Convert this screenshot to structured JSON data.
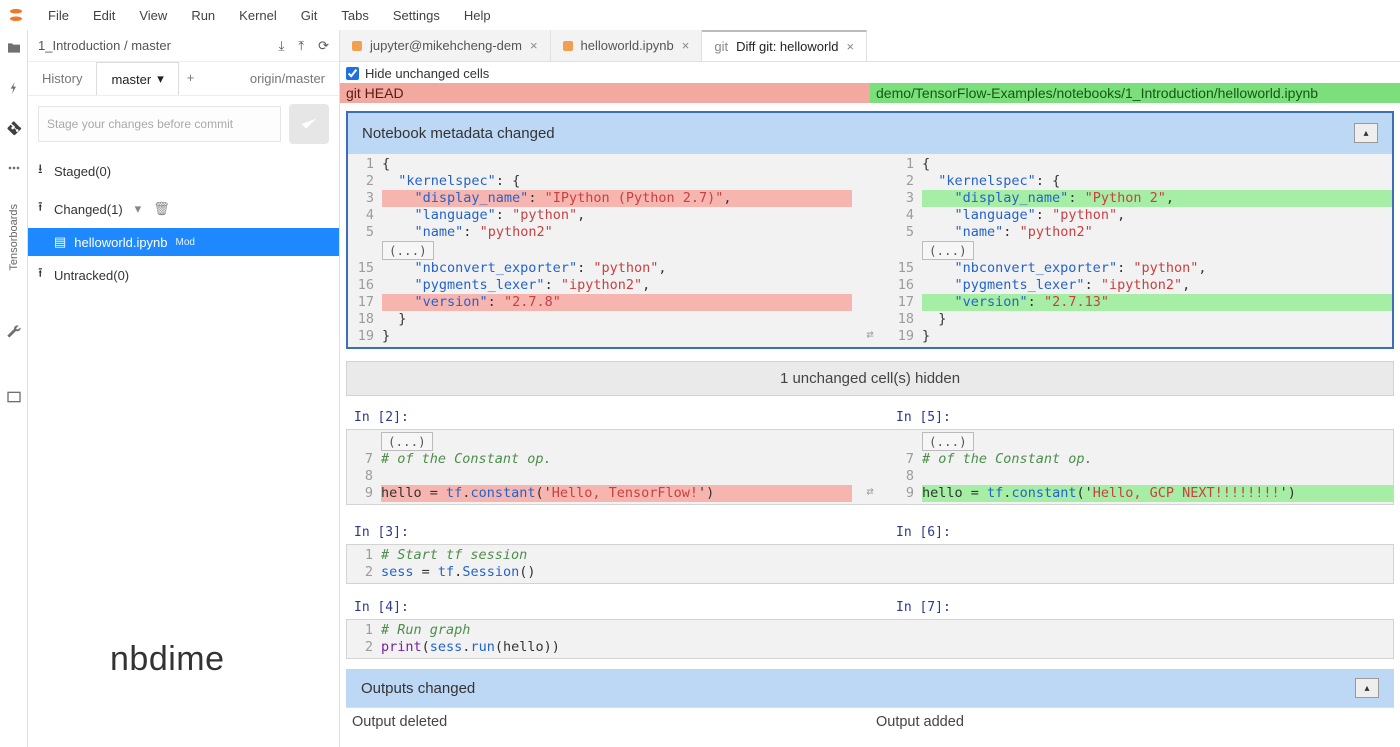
{
  "menu": {
    "items": [
      "File",
      "Edit",
      "View",
      "Run",
      "Kernel",
      "Git",
      "Tabs",
      "Settings",
      "Help"
    ]
  },
  "activity": {
    "sidetext": "Tensorboards"
  },
  "sidebar": {
    "breadcrumb": "1_Introduction / master",
    "tabs": {
      "history": "History",
      "active_branch": "master",
      "remote": "origin/master"
    },
    "commit_placeholder": "Stage your changes before commit",
    "sections": {
      "staged": "Staged(0)",
      "changed": "Changed(1)",
      "untracked": "Untracked(0)"
    },
    "changed_file": {
      "name": "helloworld.ipynb",
      "badge": "Mod"
    }
  },
  "editor_tabs": [
    {
      "dot": "#f0a050",
      "label": "jupyter@mikehcheng-dem",
      "close": "×"
    },
    {
      "dot": "#f0a050",
      "label": "helloworld.ipynb",
      "close": "×"
    },
    {
      "dot": "",
      "label": "Diff git: helloworld",
      "prefix": "git",
      "close": "×",
      "active": true
    }
  ],
  "diff": {
    "hide_checkbox_label": "Hide unchanged cells",
    "banner_left": "git HEAD",
    "banner_right": "demo/TensorFlow-Examples/notebooks/1_Introduction/helloworld.ipynb",
    "meta_title": "Notebook metadata changed",
    "left_lines": [
      {
        "n": "1",
        "t": "{"
      },
      {
        "n": "2",
        "t": "  \"kernelspec\": {"
      },
      {
        "n": "3",
        "t": "    \"display_name\": \"IPython (Python 2.7)\",",
        "cls": "del"
      },
      {
        "n": "4",
        "t": "    \"language\": \"python\","
      },
      {
        "n": "5",
        "t": "    \"name\": \"python2\""
      }
    ],
    "left_fold": "(...)",
    "left_lines2": [
      {
        "n": "15",
        "t": "    \"nbconvert_exporter\": \"python\","
      },
      {
        "n": "16",
        "t": "    \"pygments_lexer\": \"ipython2\","
      },
      {
        "n": "17",
        "t": "    \"version\": \"2.7.8\"",
        "cls": "del"
      },
      {
        "n": "18",
        "t": "  }"
      },
      {
        "n": "19",
        "t": "}"
      }
    ],
    "right_lines": [
      {
        "n": "1",
        "t": "{"
      },
      {
        "n": "2",
        "t": "  \"kernelspec\": {"
      },
      {
        "n": "3",
        "t": "    \"display_name\": \"Python 2\",",
        "cls": "add"
      },
      {
        "n": "4",
        "t": "    \"language\": \"python\","
      },
      {
        "n": "5",
        "t": "    \"name\": \"python2\""
      }
    ],
    "right_fold": "(...)",
    "right_lines2": [
      {
        "n": "15",
        "t": "    \"nbconvert_exporter\": \"python\","
      },
      {
        "n": "16",
        "t": "    \"pygments_lexer\": \"ipython2\","
      },
      {
        "n": "17",
        "t": "    \"version\": \"2.7.13\"",
        "cls": "add"
      },
      {
        "n": "18",
        "t": "  }"
      },
      {
        "n": "19",
        "t": "}"
      }
    ],
    "hidden_msg": "1 unchanged cell(s) hidden",
    "cell2": {
      "left_prompt": "In [2]:",
      "right_prompt": "In [5]:",
      "fold": "(...)",
      "left_lines": [
        {
          "n": "7",
          "t": "# of the Constant op.",
          "cls": "cmt"
        },
        {
          "n": "8",
          "t": ""
        },
        {
          "n": "9",
          "t": "hello = tf.constant('Hello, TensorFlow!')",
          "cls": "del"
        }
      ],
      "right_lines": [
        {
          "n": "7",
          "t": "# of the Constant op.",
          "cls": "cmt"
        },
        {
          "n": "8",
          "t": ""
        },
        {
          "n": "9",
          "t": "hello = tf.constant('Hello, GCP NEXT!!!!!!!!')",
          "cls": "add"
        }
      ]
    },
    "cell3": {
      "left_prompt": "In [3]:",
      "right_prompt": "In [6]:",
      "lines": [
        {
          "n": "1",
          "t": "# Start tf session",
          "cls": "cmt"
        },
        {
          "n": "2",
          "t": "sess = tf.Session()"
        }
      ]
    },
    "cell4": {
      "left_prompt": "In [4]:",
      "right_prompt": "In [7]:",
      "lines": [
        {
          "n": "1",
          "t": "# Run graph",
          "cls": "cmt"
        },
        {
          "n": "2",
          "t": "print(sess.run(hello))"
        }
      ]
    },
    "outputs_title": "Outputs changed",
    "output_deleted": "Output deleted",
    "output_added": "Output added"
  },
  "brand": "nbdime"
}
